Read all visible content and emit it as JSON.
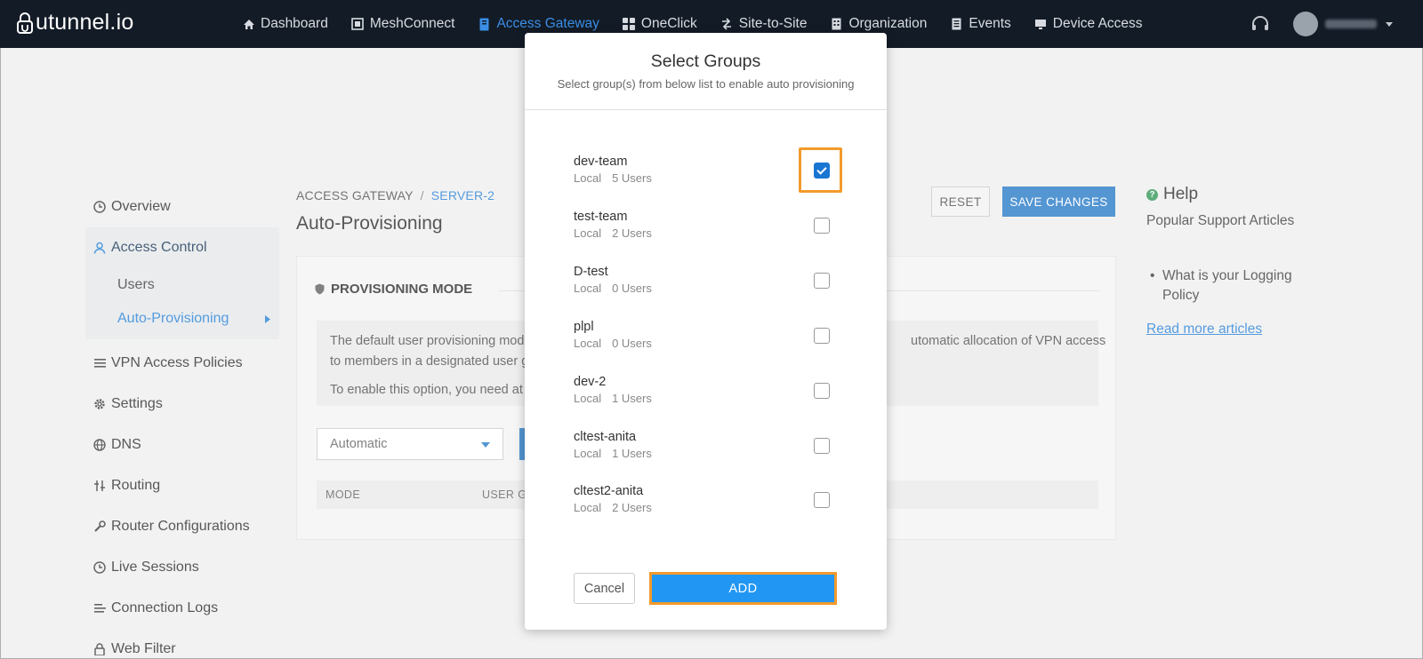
{
  "app": {
    "logo_text": "utunnel.io",
    "user_name_blurred": "",
    "colors": {
      "nav_bg": "#131b26",
      "accent": "#2f7fc9",
      "active_nav": "#3a8ee6",
      "highlight": "#f39a2c"
    }
  },
  "nav": {
    "items": [
      {
        "label": "Dashboard",
        "icon": "home-icon"
      },
      {
        "label": "MeshConnect",
        "icon": "mesh-icon"
      },
      {
        "label": "Access Gateway",
        "icon": "gateway-icon",
        "active": true
      },
      {
        "label": "OneClick",
        "icon": "grid-icon"
      },
      {
        "label": "Site-to-Site",
        "icon": "link-icon"
      },
      {
        "label": "Organization",
        "icon": "building-icon"
      },
      {
        "label": "Events",
        "icon": "events-icon"
      },
      {
        "label": "Device Access",
        "icon": "monitor-icon"
      }
    ]
  },
  "sidebar": {
    "items": [
      {
        "label": "Overview",
        "icon": "clock-icon"
      },
      {
        "label": "Access Control",
        "icon": "user-icon"
      },
      {
        "label": "VPN Access Policies",
        "icon": "list-icon"
      },
      {
        "label": "Settings",
        "icon": "gear-icon"
      },
      {
        "label": "DNS",
        "icon": "globe-icon"
      },
      {
        "label": "Routing",
        "icon": "routing-icon"
      },
      {
        "label": "Router Configurations",
        "icon": "wrench-icon"
      },
      {
        "label": "Live Sessions",
        "icon": "clock-icon"
      },
      {
        "label": "Connection Logs",
        "icon": "list-icon"
      },
      {
        "label": "Web Filter",
        "icon": "lock-icon"
      }
    ],
    "sub_items": [
      {
        "label": "Users"
      },
      {
        "label": "Auto-Provisioning",
        "active": true
      }
    ]
  },
  "breadcrumb": {
    "root": "ACCESS GATEWAY",
    "separator": "/",
    "current": "SERVER-2"
  },
  "page": {
    "title": "Auto-Provisioning",
    "reset_label": "RESET",
    "save_label": "SAVE CHANGES",
    "section_title": "PROVISIONING MODE",
    "info_line1": "The default user provisioning mode",
    "info_line2": "to members in a designated user g",
    "info_line3": "To enable this option, you need at",
    "info_right": "utomatic allocation of VPN access",
    "mode_select": "Automatic",
    "table_headers": [
      "MODE",
      "USER G"
    ]
  },
  "help": {
    "title": "Help",
    "subtitle": "Popular Support Articles",
    "articles": [
      "What is your Logging Policy"
    ],
    "read_more": "Read more articles"
  },
  "modal": {
    "title": "Select Groups",
    "subtitle": "Select group(s) from below list to enable auto provisioning",
    "groups": [
      {
        "name": "dev-team",
        "source": "Local",
        "users": "5 Users",
        "checked": true
      },
      {
        "name": "test-team",
        "source": "Local",
        "users": "2 Users",
        "checked": false
      },
      {
        "name": "D-test",
        "source": "Local",
        "users": "0 Users",
        "checked": false
      },
      {
        "name": "plpl",
        "source": "Local",
        "users": "0 Users",
        "checked": false
      },
      {
        "name": "dev-2",
        "source": "Local",
        "users": "1 Users",
        "checked": false
      },
      {
        "name": "cltest-anita",
        "source": "Local",
        "users": "1 Users",
        "checked": false
      },
      {
        "name": "cltest2-anita",
        "source": "Local",
        "users": "2 Users",
        "checked": false
      }
    ],
    "cancel_label": "Cancel",
    "add_label": "ADD"
  }
}
